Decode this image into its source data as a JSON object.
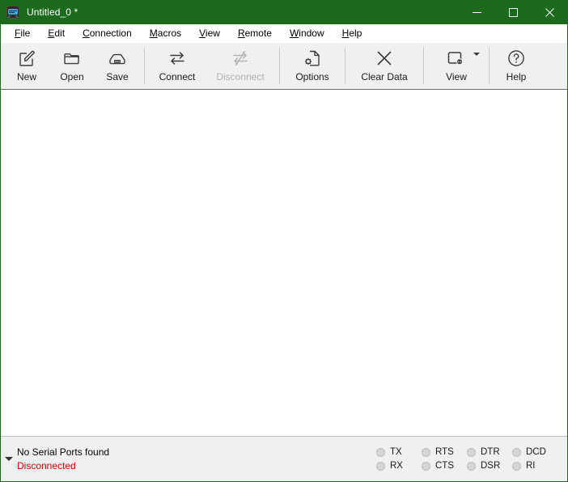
{
  "window": {
    "title": "Untitled_0 *",
    "app_icon": "serial-terminal-icon",
    "frame_color": "#1c6b1c",
    "controls": {
      "minimize": "—",
      "maximize": "□",
      "close": "✕"
    }
  },
  "menubar": {
    "items": [
      {
        "label": "File",
        "accel": "F",
        "rest": "ile"
      },
      {
        "label": "Edit",
        "accel": "E",
        "rest": "dit"
      },
      {
        "label": "Connection",
        "accel": "C",
        "rest": "onnection"
      },
      {
        "label": "Macros",
        "accel": "M",
        "rest": "acros"
      },
      {
        "label": "View",
        "accel": "V",
        "rest": "iew"
      },
      {
        "label": "Remote",
        "accel": "R",
        "rest": "emote"
      },
      {
        "label": "Window",
        "accel": "W",
        "rest": "indow"
      },
      {
        "label": "Help",
        "accel": "H",
        "rest": "elp"
      }
    ]
  },
  "toolbar": {
    "new_label": "New",
    "open_label": "Open",
    "save_label": "Save",
    "connect_label": "Connect",
    "disconnect_label": "Disconnect",
    "options_label": "Options",
    "clear_data_label": "Clear Data",
    "view_label": "View",
    "help_label": "Help",
    "disconnect_enabled": false,
    "icons": {
      "new": "new-document-pencil-icon",
      "open": "folder-open-icon",
      "save": "save-drive-icon",
      "connect": "connect-arrows-icon",
      "disconnect": "disconnect-arrows-slashed-icon",
      "options": "document-gear-icon",
      "clear_data": "close-x-icon",
      "view": "window-dropdown-icon",
      "help": "question-circle-icon"
    }
  },
  "terminal": {
    "content": "",
    "background": "#ffffff"
  },
  "statusbar": {
    "port_status": "No Serial Ports found",
    "connection_status": "Disconnected",
    "connection_color": "#d40000",
    "expander_icon": "chevron-down-icon",
    "led_columns": [
      {
        "top": "TX",
        "bottom": "RX"
      },
      {
        "top": "RTS",
        "bottom": "CTS"
      },
      {
        "top": "DTR",
        "bottom": "DSR"
      },
      {
        "top": "DCD",
        "bottom": "RI"
      }
    ],
    "led_inactive_color": "#d4d4d4"
  }
}
